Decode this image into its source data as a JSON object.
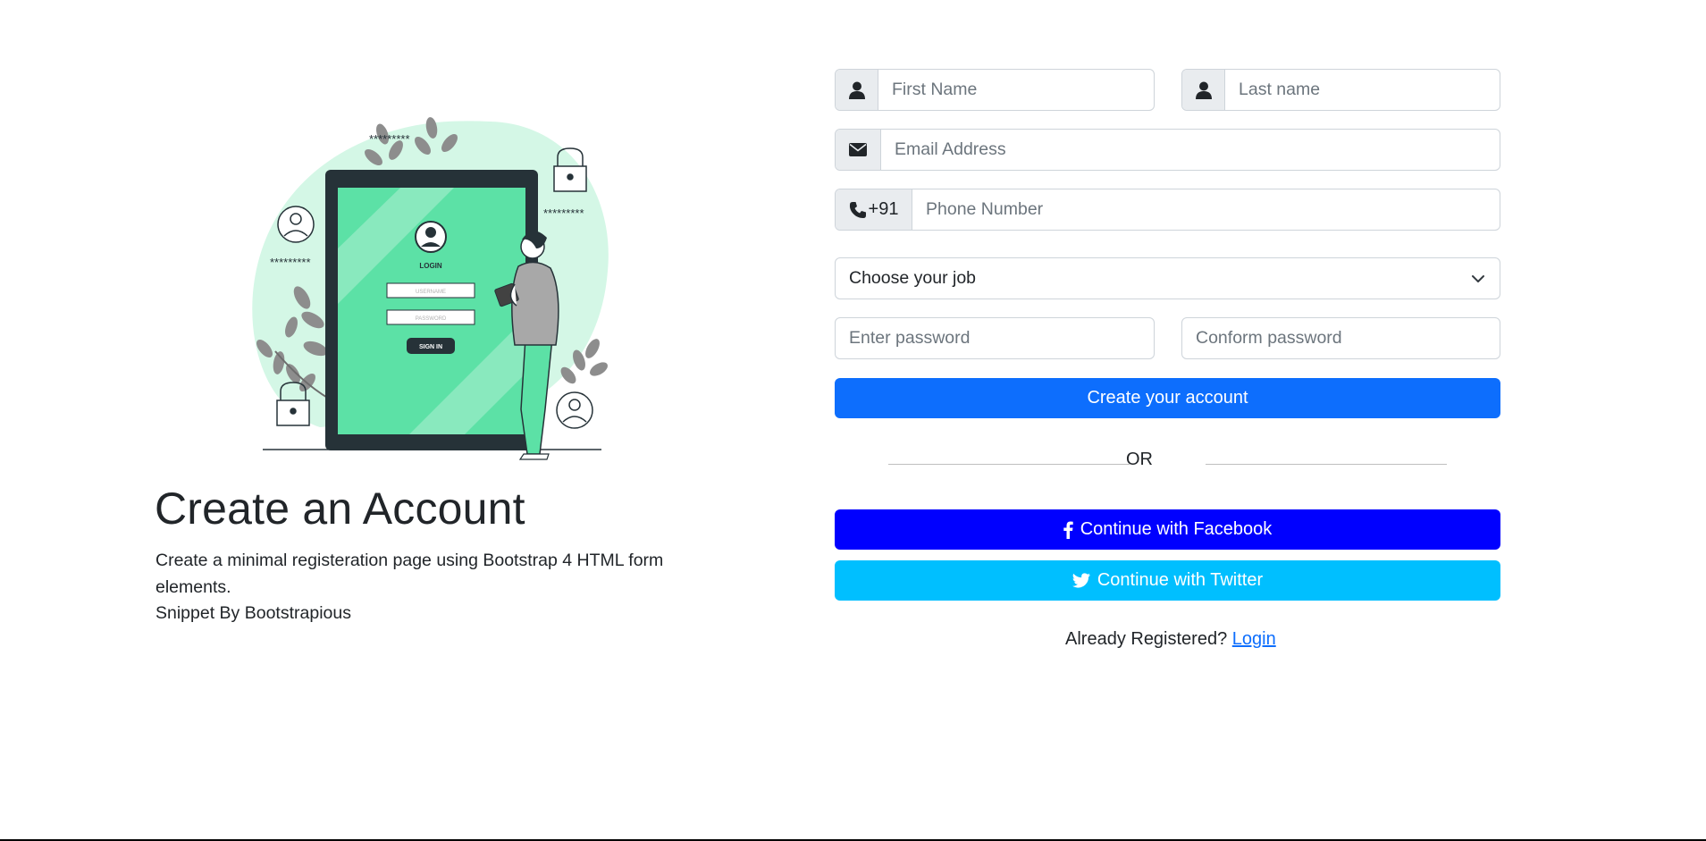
{
  "hero": {
    "title": "Create an Account",
    "description": "Create a minimal registeration page using Bootstrap 4 HTML form elements.",
    "credit": "Snippet By Bootstrapious"
  },
  "illustration": {
    "login_label": "LOGIN",
    "username_placeholder": "USERNAME",
    "password_placeholder": "PASSWORD",
    "signin_label": "SIGN IN",
    "masked_text": "*********"
  },
  "form": {
    "first_name": {
      "placeholder": "First Name",
      "icon": "user-icon"
    },
    "last_name": {
      "placeholder": "Last name",
      "icon": "user-icon"
    },
    "email": {
      "placeholder": "Email Address",
      "icon": "envelope-icon"
    },
    "phone": {
      "country_code": "+91",
      "placeholder": "Phone Number",
      "icon": "phone-icon"
    },
    "job": {
      "selected": "Choose your job"
    },
    "password": {
      "placeholder": "Enter password"
    },
    "confirm_password": {
      "placeholder": "Conform password"
    },
    "submit_label": "Create your account",
    "divider_text": "OR",
    "facebook_label": "Continue with Facebook",
    "twitter_label": "Continue with Twitter",
    "already_registered": "Already Registered?",
    "login_link": "Login"
  },
  "colors": {
    "primary": "#0d6efd",
    "facebook": "#0000ff",
    "twitter": "#00bfff",
    "illustration_green": "#5ce1a6",
    "illustration_blob": "#d4f7e6"
  }
}
